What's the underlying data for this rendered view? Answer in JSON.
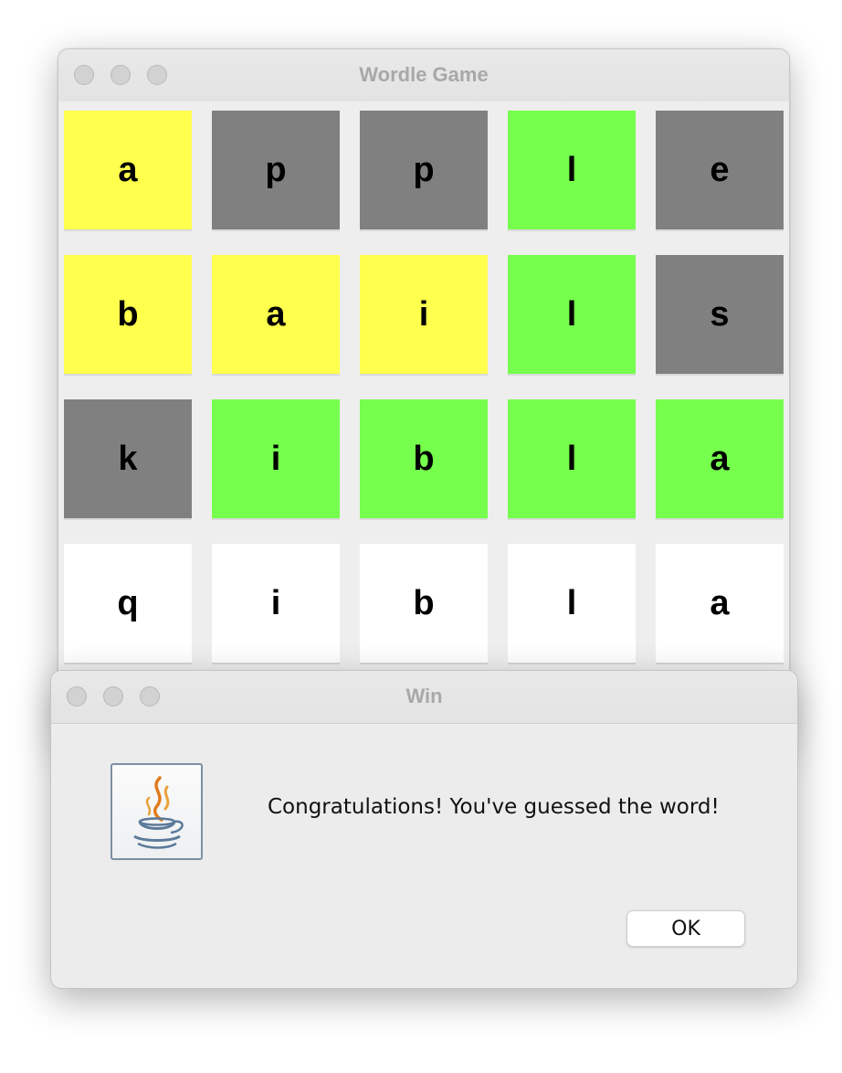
{
  "main_window": {
    "title": "Wordle Game",
    "grid": [
      [
        {
          "letter": "a",
          "state": "present"
        },
        {
          "letter": "p",
          "state": "absent"
        },
        {
          "letter": "p",
          "state": "absent"
        },
        {
          "letter": "l",
          "state": "correct"
        },
        {
          "letter": "e",
          "state": "absent"
        }
      ],
      [
        {
          "letter": "b",
          "state": "present"
        },
        {
          "letter": "a",
          "state": "present"
        },
        {
          "letter": "i",
          "state": "present"
        },
        {
          "letter": "l",
          "state": "correct"
        },
        {
          "letter": "s",
          "state": "absent"
        }
      ],
      [
        {
          "letter": "k",
          "state": "absent"
        },
        {
          "letter": "i",
          "state": "correct"
        },
        {
          "letter": "b",
          "state": "correct"
        },
        {
          "letter": "l",
          "state": "correct"
        },
        {
          "letter": "a",
          "state": "correct"
        }
      ],
      [
        {
          "letter": "q",
          "state": "empty"
        },
        {
          "letter": "i",
          "state": "empty"
        },
        {
          "letter": "b",
          "state": "empty"
        },
        {
          "letter": "l",
          "state": "empty"
        },
        {
          "letter": "a",
          "state": "empty"
        }
      ]
    ]
  },
  "colors": {
    "present": "#ffff4d",
    "absent": "#808080",
    "correct": "#76ff4d",
    "empty": "#ffffff"
  },
  "dialog": {
    "title": "Win",
    "icon": "java-coffee-cup-icon",
    "message": "Congratulations! You've guessed the word!",
    "ok_label": "OK"
  }
}
